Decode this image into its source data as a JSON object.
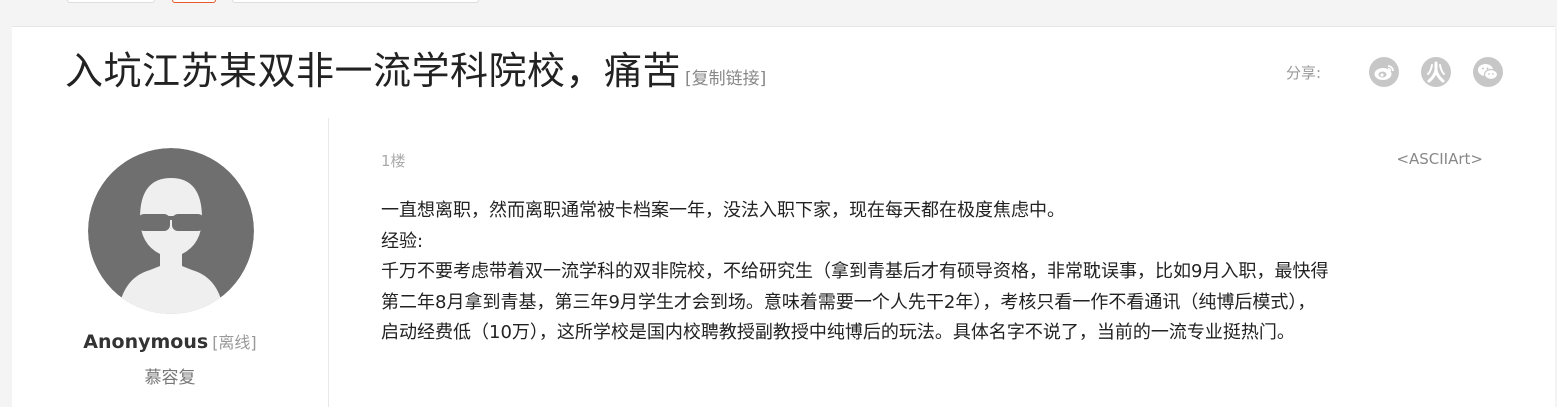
{
  "thread": {
    "title": "入坑江苏某双非一流学科院校，痛苦",
    "copy_link": "[复制链接]"
  },
  "share": {
    "label": "分享:",
    "icons": [
      "weibo-icon",
      "renren-icon",
      "wechat-icon"
    ]
  },
  "post": {
    "author": {
      "name": "Anonymous",
      "status": "[离线]",
      "subtitle": "慕容复",
      "avatar_icon": "anonymous-avatar-icon"
    },
    "floor": "1楼",
    "signature": "<ASCIIArt>",
    "lines": [
      "一直想离职，然而离职通常被卡档案一年，没法入职下家，现在每天都在极度焦虑中。",
      "经验:",
      "千万不要考虑带着双一流学科的双非院校，不给研究生（拿到青基后才有硕导资格，非常耽误事，比如9月入职，最快得",
      "第二年8月拿到青基，第三年9月学生才会到场。意味着需要一个人先干2年），考核只看一作不看通讯（纯博后模式），",
      "启动经费低（10万），这所学校是国内校聘教授副教授中纯博后的玩法。具体名字不说了，当前的一流专业挺热门。"
    ]
  },
  "colors": {
    "page_bg": "#f4f4f4",
    "panel_bg": "#ffffff",
    "accent": "#e45a28",
    "icon_gray": "#c7c7c7"
  }
}
